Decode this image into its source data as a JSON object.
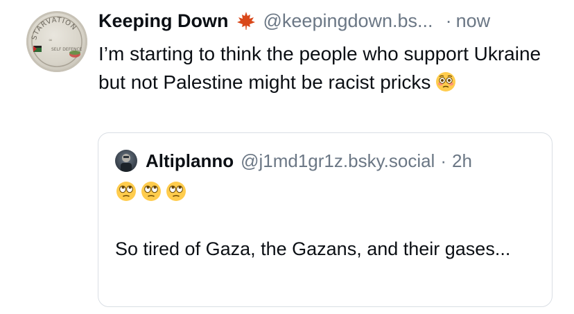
{
  "post": {
    "author_name": "Keeping Down",
    "author_badge_icon": "maple-leaf-icon",
    "handle": "@keepingdown.bs...",
    "separator": "·",
    "time": "now",
    "avatar_text": {
      "top": "STARVATION",
      "middle": "SELF DEFENCE"
    },
    "text": "I’m starting to think the people who support Ukraine but not Palestine might be racist pricks",
    "text_emoji": "flushed-face-emoji"
  },
  "quote": {
    "author_name": "Altiplanno",
    "handle": "@j1md1gr1z.bsky.social",
    "separator": "·",
    "time": "2h",
    "emojis": [
      "face-with-rolling-eyes-emoji",
      "face-with-rolling-eyes-emoji",
      "face-with-rolling-eyes-emoji"
    ],
    "text": "So tired of Gaza, the Gazans, and their gases..."
  },
  "colors": {
    "text": "#0b0f14",
    "muted": "#6b7785",
    "border": "#d9dee4",
    "leaf": "#d9481a"
  }
}
